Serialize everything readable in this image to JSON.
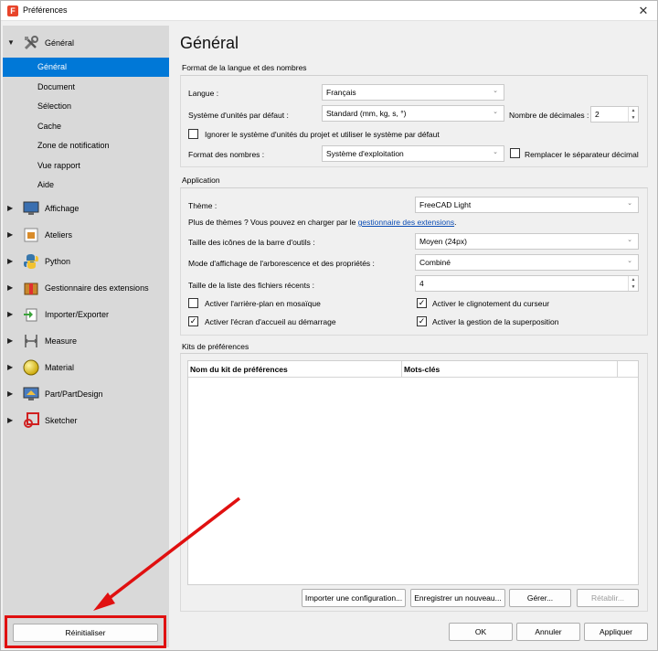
{
  "window": {
    "title": "Préférences",
    "close": "✕",
    "app_icon": "F"
  },
  "sidebar": {
    "items": [
      {
        "label": "Général",
        "expanded": true,
        "icon": "tools-icon"
      },
      {
        "label": "Affichage",
        "icon": "monitor-icon"
      },
      {
        "label": "Ateliers",
        "icon": "workbench-icon"
      },
      {
        "label": "Python",
        "icon": "python-icon"
      },
      {
        "label": "Gestionnaire des extensions",
        "icon": "package-icon"
      },
      {
        "label": "Importer/Exporter",
        "icon": "import-export-icon"
      },
      {
        "label": "Measure",
        "icon": "measure-icon"
      },
      {
        "label": "Material",
        "icon": "material-sphere-icon"
      },
      {
        "label": "Part/PartDesign",
        "icon": "part-icon"
      },
      {
        "label": "Sketcher",
        "icon": "sketcher-icon"
      }
    ],
    "subitems": [
      "Général",
      "Document",
      "Sélection",
      "Cache",
      "Zone de notification",
      "Vue rapport",
      "Aide"
    ],
    "selected": "Général",
    "reset_label": "Réinitialiser"
  },
  "main": {
    "title": "Général",
    "lang_group": {
      "title": "Format de la langue et des nombres",
      "language_label": "Langue :",
      "language_value": "Français",
      "units_label": "Système d'unités par défaut :",
      "units_value": "Standard (mm, kg, s, °)",
      "decimals_label": "Nombre de décimales :",
      "decimals_value": "2",
      "ignore_units_label": "Ignorer le système d'unités du projet et utiliser le système par défaut",
      "ignore_units_checked": false,
      "number_format_label": "Format des nombres :",
      "number_format_value": "Système d'exploitation",
      "replace_sep_label": "Remplacer le séparateur décimal",
      "replace_sep_checked": false
    },
    "app_group": {
      "title": "Application",
      "theme_label": "Thème :",
      "theme_value": "FreeCAD Light",
      "more_themes_text": "Plus de thèmes ? Vous pouvez en charger par le ",
      "more_themes_link": "gestionnaire des extensions",
      "more_themes_end": ".",
      "icon_size_label": "Taille des icônes de la barre d'outils :",
      "icon_size_value": "Moyen (24px)",
      "tree_mode_label": "Mode d'affichage de l'arborescence et des propriétés :",
      "tree_mode_value": "Combiné",
      "recent_label": "Taille de la liste des fichiers récents :",
      "recent_value": "4",
      "tile_bg_label": "Activer l'arrière-plan en mosaïque",
      "tile_bg_checked": false,
      "cursor_blink_label": "Activer le clignotement du curseur",
      "cursor_blink_checked": true,
      "splash_label": "Activer l'écran d'accueil au démarrage",
      "splash_checked": true,
      "overlay_label": "Activer la gestion de la superposition",
      "overlay_checked": true,
      "check_mark": "✓"
    },
    "kits_group": {
      "title": "Kits de préférences",
      "columns": [
        "Nom du kit de préférences",
        "Mots-clés"
      ],
      "import_btn": "Importer une configuration...",
      "save_btn": "Enregistrer un nouveau...",
      "manage_btn": "Gérer...",
      "restore_btn": "Rétablir..."
    },
    "footer": {
      "ok": "OK",
      "cancel": "Annuler",
      "apply": "Appliquer"
    }
  },
  "colors": {
    "selection": "#0078d7",
    "annotation": "#e01010",
    "link": "#0b4db5"
  }
}
